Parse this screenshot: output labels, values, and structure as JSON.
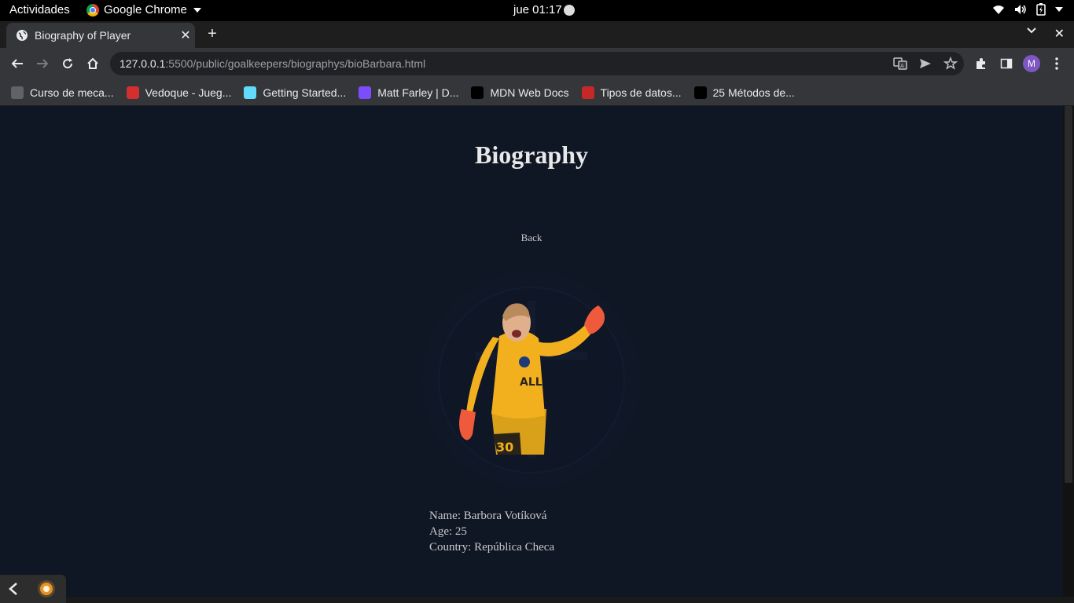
{
  "system_bar": {
    "activities": "Actividades",
    "app_name": "Google Chrome",
    "clock": "jue 01:17"
  },
  "tab": {
    "title": "Biography of Player"
  },
  "omnibox": {
    "url_host": "127.0.0.1",
    "url_path": ":5500/public/goalkeepers/biographys/bioBarbara.html",
    "avatar_letter": "M"
  },
  "bookmarks": [
    {
      "label": "Curso de meca...",
      "icon": "globe-icon",
      "color": "#5f6368"
    },
    {
      "label": "Vedoque - Jueg...",
      "icon": "vedoque-icon",
      "color": "#d32f2f"
    },
    {
      "label": "Getting Started...",
      "icon": "react-icon",
      "color": "#61dafb"
    },
    {
      "label": "Matt Farley | D...",
      "icon": "matt-farley-icon",
      "color": "#7c4dff"
    },
    {
      "label": "MDN Web Docs",
      "icon": "mdn-icon",
      "color": "#000000"
    },
    {
      "label": "Tipos de datos...",
      "icon": "tipos-icon",
      "color": "#c62828"
    },
    {
      "label": "25 Métodos de...",
      "icon": "dev-icon",
      "color": "#000000"
    }
  ],
  "page": {
    "heading": "Biography",
    "back": "Back",
    "player": {
      "name_line": "Name: Barbora Votíková",
      "age_line": "Age: 25",
      "country_line": "Country: República Checa",
      "shirt_number": "30"
    }
  },
  "colors": {
    "page_bg": "#0f1624",
    "kit_yellow": "#f2b01e",
    "glove_orange": "#ef5a3c"
  }
}
